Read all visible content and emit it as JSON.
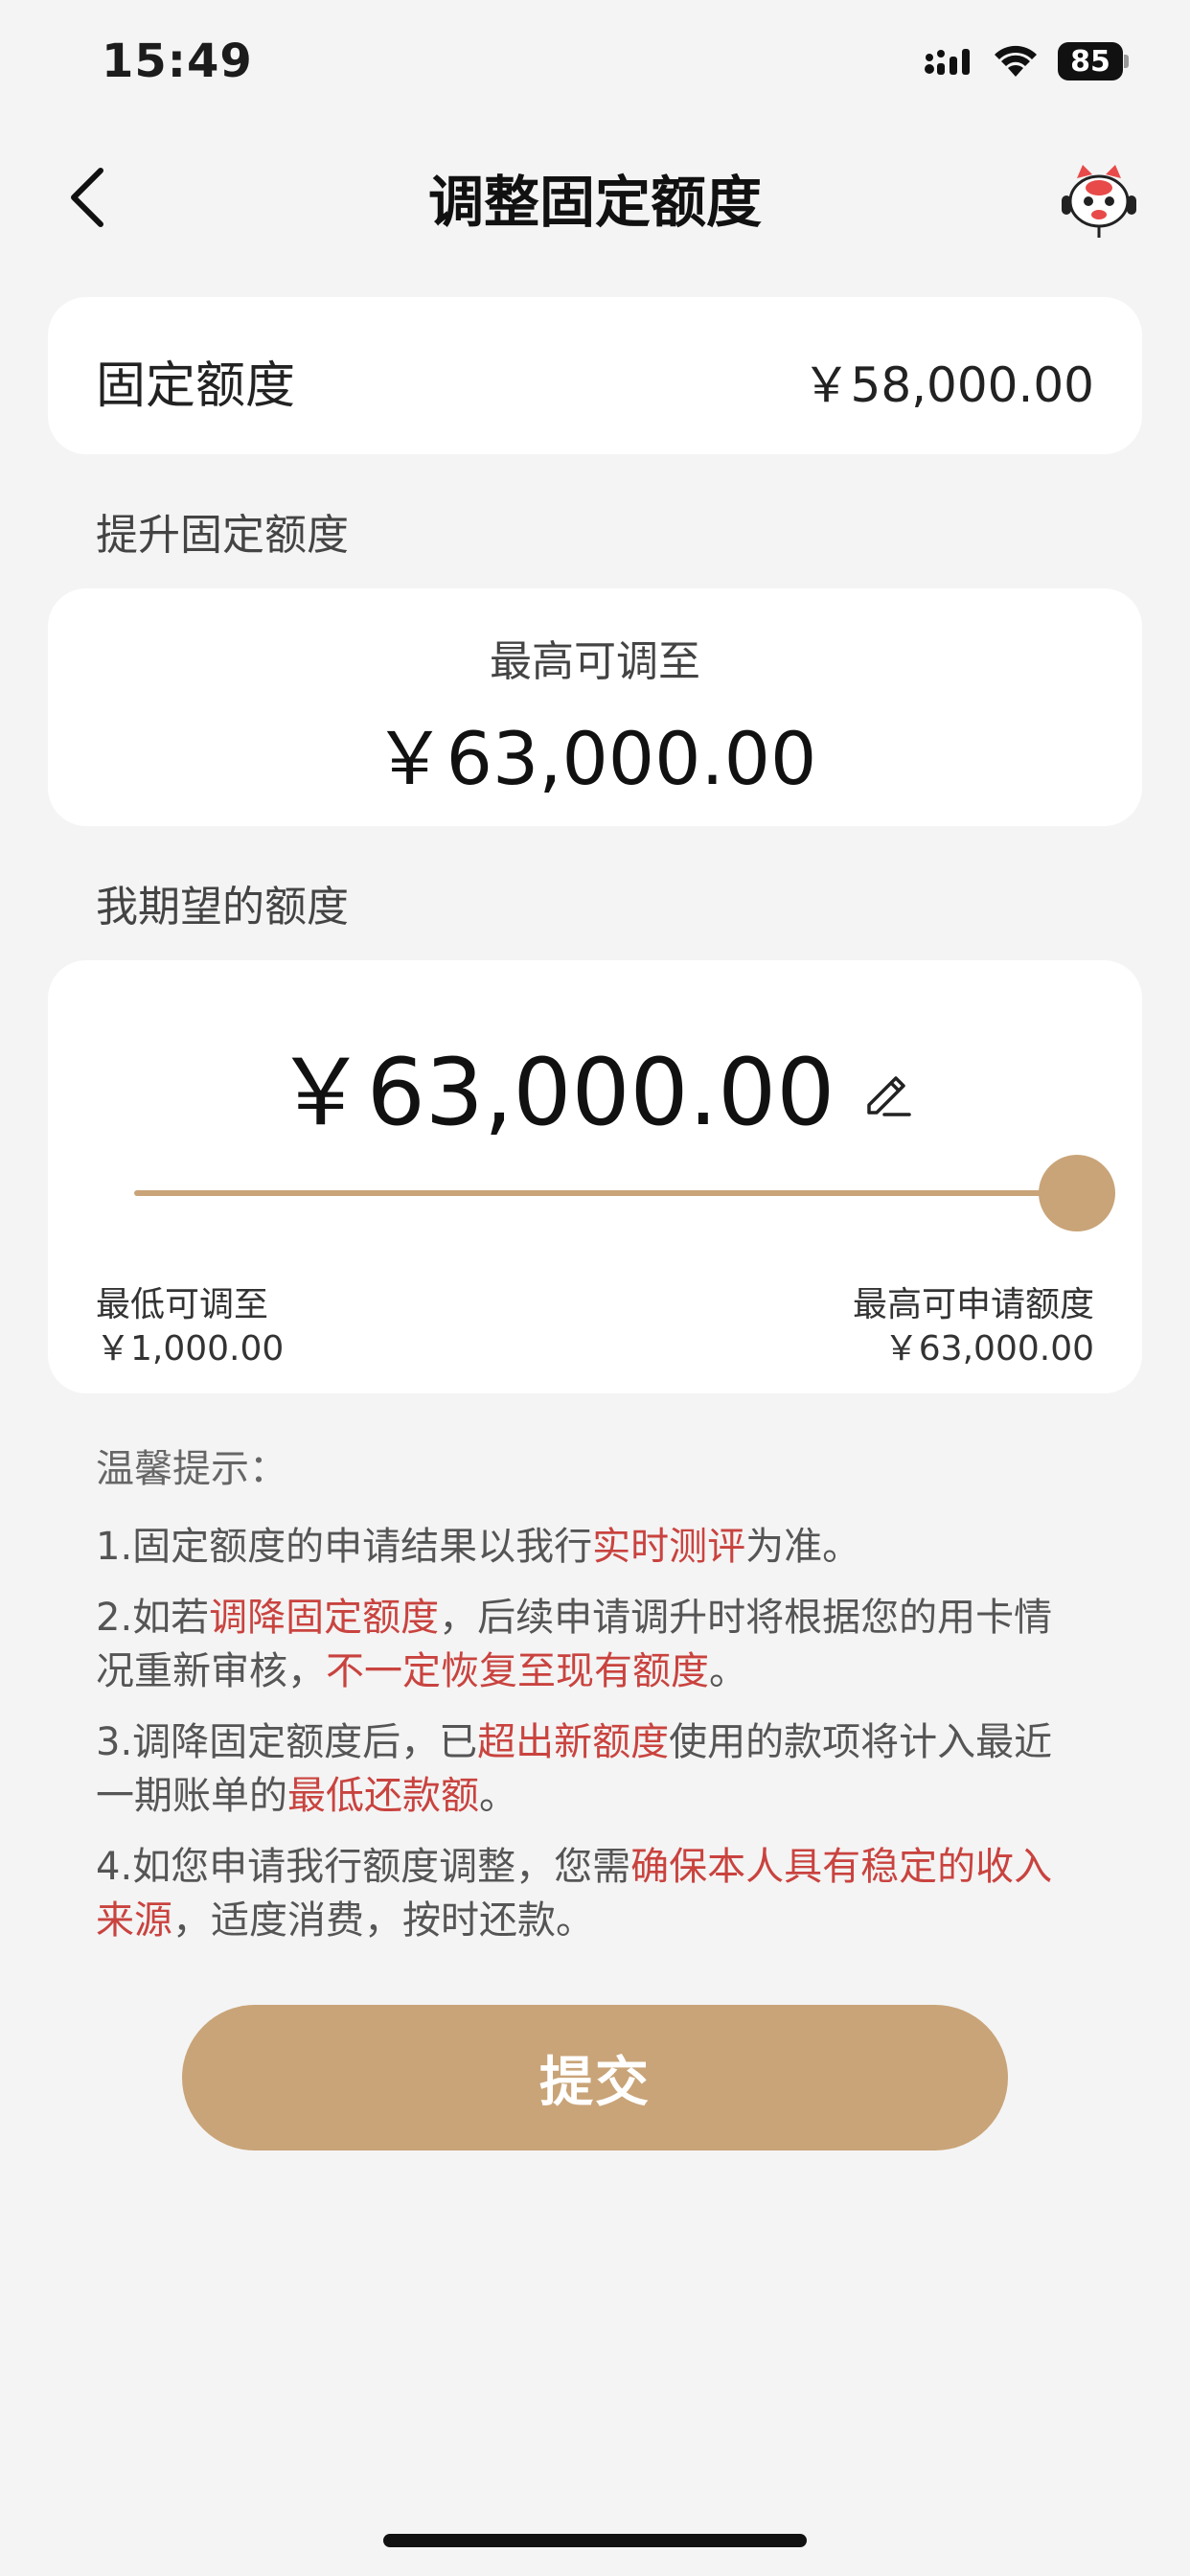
{
  "status_bar": {
    "time": "15:49",
    "battery": "85",
    "icons": [
      "signal-icon",
      "wifi-icon",
      "battery-icon"
    ]
  },
  "nav": {
    "title": "调整固定额度",
    "back_icon": "chevron-left-icon",
    "assistant_icon": "mascot-assistant-icon"
  },
  "current_limit": {
    "label": "固定额度",
    "value": "￥58,000.00"
  },
  "raise_section": {
    "label": "提升固定额度",
    "max_caption": "最高可调至",
    "max_amount": "￥63,000.00"
  },
  "expect_section": {
    "label": "我期望的额度",
    "amount": "￥63,000.00",
    "edit_icon": "pencil-icon",
    "slider_fraction": 1.0,
    "min_label": "最低可调至",
    "min_value": "￥1,000.00",
    "max_label": "最高可申请额度",
    "max_value": "￥63,000.00"
  },
  "tips": {
    "title": "温馨提示：",
    "items": [
      {
        "parts": [
          {
            "t": "1.固定额度的申请结果以我行"
          },
          {
            "t": "实时测评",
            "hl": true
          },
          {
            "t": "为准。"
          }
        ]
      },
      {
        "parts": [
          {
            "t": "2.如若"
          },
          {
            "t": "调降固定额度",
            "hl": true
          },
          {
            "t": "，后续申请调升时将根据您的用卡情况重新审核，"
          },
          {
            "t": "不一定恢复至现有额度",
            "hl": true
          },
          {
            "t": "。"
          }
        ]
      },
      {
        "parts": [
          {
            "t": "3.调降固定额度后，已"
          },
          {
            "t": "超出新额度",
            "hl": true
          },
          {
            "t": "使用的款项将计入最近一期账单的"
          },
          {
            "t": "最低还款额",
            "hl": true
          },
          {
            "t": "。"
          }
        ]
      },
      {
        "parts": [
          {
            "t": "4.如您申请我行额度调整，您需"
          },
          {
            "t": "确保本人具有稳定的收入来源",
            "hl": true
          },
          {
            "t": "，适度消费，按时还款。"
          }
        ]
      }
    ]
  },
  "submit": {
    "label": "提交"
  },
  "colors": {
    "accent": "#c9a478",
    "highlight": "#c9433f",
    "background": "#f4f4f4"
  }
}
